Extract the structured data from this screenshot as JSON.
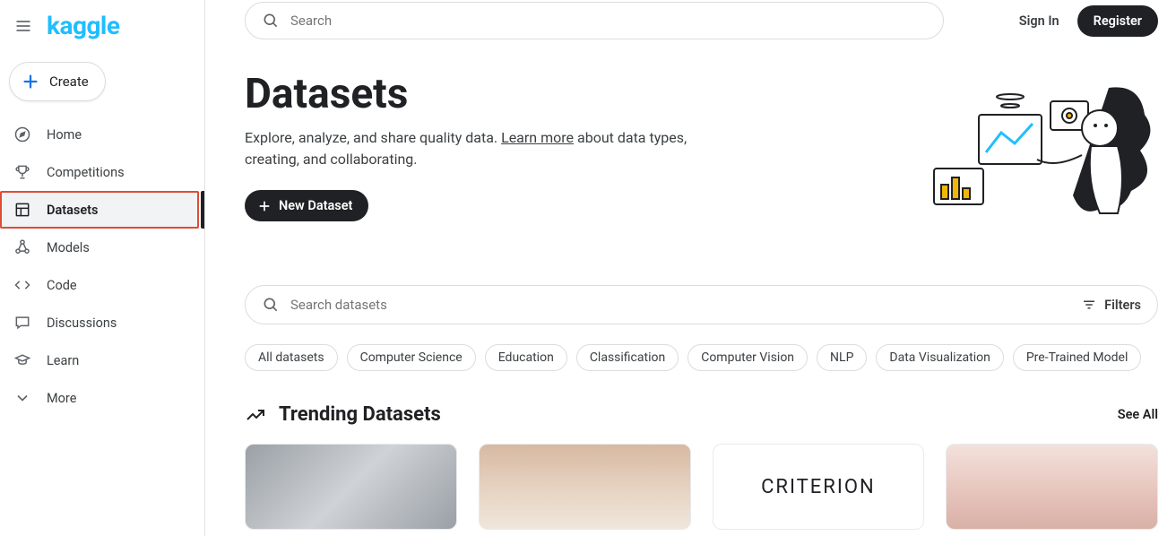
{
  "brand": {
    "logo_text": "kaggle"
  },
  "sidebar": {
    "create_label": "Create",
    "items": [
      {
        "label": "Home"
      },
      {
        "label": "Competitions"
      },
      {
        "label": "Datasets"
      },
      {
        "label": "Models"
      },
      {
        "label": "Code"
      },
      {
        "label": "Discussions"
      },
      {
        "label": "Learn"
      },
      {
        "label": "More"
      }
    ]
  },
  "topbar": {
    "search_placeholder": "Search",
    "sign_in": "Sign In",
    "register": "Register"
  },
  "hero": {
    "title": "Datasets",
    "desc_pre": "Explore, analyze, and share quality data. ",
    "learn_more": "Learn more",
    "desc_post": " about data types, creating, and collaborating.",
    "new_dataset": "New Dataset"
  },
  "datasets_search": {
    "placeholder": "Search datasets",
    "filters_label": "Filters"
  },
  "chips": [
    "All datasets",
    "Computer Science",
    "Education",
    "Classification",
    "Computer Vision",
    "NLP",
    "Data Visualization",
    "Pre-Trained Model"
  ],
  "trending": {
    "title": "Trending Datasets",
    "see_all": "See All"
  },
  "cards": {
    "criterion_label": "CRITERION"
  }
}
